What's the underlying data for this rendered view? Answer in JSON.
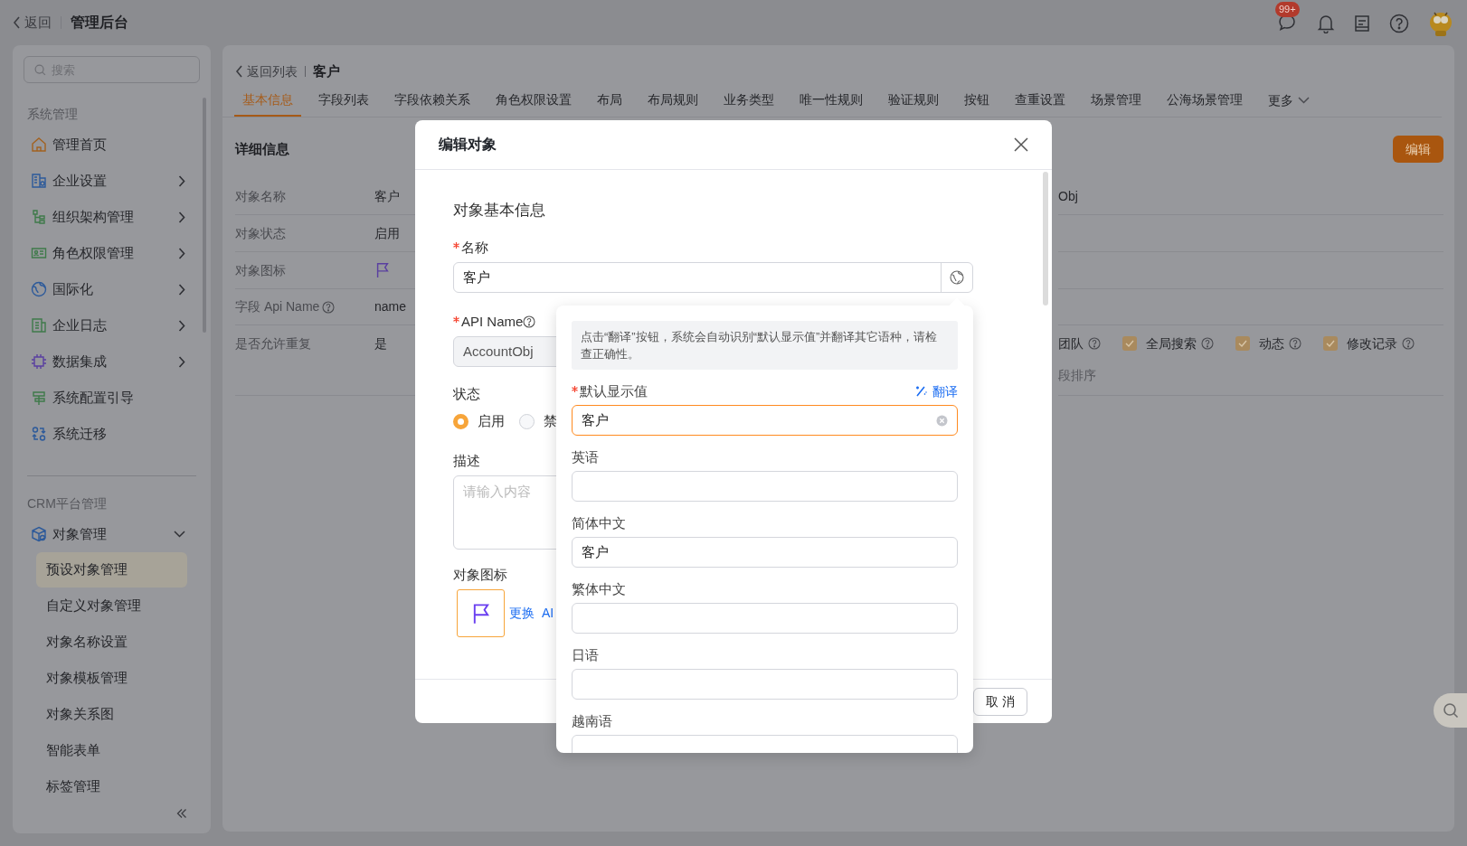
{
  "top_bar": {
    "back": "返回",
    "title": "管理后台",
    "notification_badge": "99+"
  },
  "sidebar": {
    "search_placeholder": "搜索",
    "sections": [
      {
        "title": "系统管理",
        "items": [
          {
            "label": "管理首页",
            "kind": "link"
          },
          {
            "label": "企业设置",
            "kind": "group",
            "expanded": false
          },
          {
            "label": "组织架构管理",
            "kind": "group",
            "expanded": false
          },
          {
            "label": "角色权限管理",
            "kind": "group",
            "expanded": false
          },
          {
            "label": "国际化",
            "kind": "group",
            "expanded": false
          },
          {
            "label": "企业日志",
            "kind": "group",
            "expanded": false
          },
          {
            "label": "数据集成",
            "kind": "group",
            "expanded": false
          },
          {
            "label": "系统配置引导",
            "kind": "link"
          },
          {
            "label": "系统迁移",
            "kind": "link"
          }
        ]
      },
      {
        "title": "CRM平台管理",
        "items": [
          {
            "label": "对象管理",
            "kind": "group",
            "expanded": true,
            "children": [
              {
                "label": "预设对象管理",
                "selected": true
              },
              {
                "label": "自定义对象管理",
                "selected": false
              },
              {
                "label": "对象名称设置",
                "selected": false
              },
              {
                "label": "对象模板管理",
                "selected": false
              },
              {
                "label": "对象关系图",
                "selected": false
              },
              {
                "label": "智能表单",
                "selected": false
              },
              {
                "label": "标签管理",
                "selected": false
              }
            ]
          }
        ]
      }
    ]
  },
  "main": {
    "back": "返回列表",
    "title": "客户",
    "tabs": [
      {
        "label": "基本信息",
        "selected": true
      },
      {
        "label": "字段列表",
        "selected": false
      },
      {
        "label": "字段依赖关系",
        "selected": false
      },
      {
        "label": "角色权限设置",
        "selected": false
      },
      {
        "label": "布局",
        "selected": false
      },
      {
        "label": "布局规则",
        "selected": false
      },
      {
        "label": "业务类型",
        "selected": false
      },
      {
        "label": "唯一性规则",
        "selected": false
      },
      {
        "label": "验证规则",
        "selected": false
      },
      {
        "label": "按钮",
        "selected": false
      },
      {
        "label": "查重设置",
        "selected": false
      },
      {
        "label": "场景管理",
        "selected": false
      },
      {
        "label": "公海场景管理",
        "selected": false
      }
    ],
    "more": "更多",
    "detail": {
      "title": "详细信息",
      "edit_button": "编辑",
      "rows": [
        {
          "label": "对象名称",
          "kind": "text",
          "value": "客户"
        },
        {
          "label": "对象状态",
          "kind": "text",
          "value": "启用"
        },
        {
          "label": "对象图标",
          "kind": "icon"
        },
        {
          "label": "字段 Api Name",
          "kind": "text",
          "help": true,
          "value": "name"
        },
        {
          "label": "是否允许重复",
          "kind": "text",
          "value": "是"
        }
      ],
      "right_value": "Obj",
      "options_lead": "团队",
      "options": [
        {
          "label": "全局搜索",
          "checked": true
        },
        {
          "label": "动态",
          "checked": true
        },
        {
          "label": "修改记录",
          "checked": true
        }
      ],
      "sort_label": "段排序"
    }
  },
  "modal": {
    "title": "编辑对象",
    "section_title": "对象基本信息",
    "name": {
      "label": "名称",
      "required": true,
      "value": "客户"
    },
    "api_name": {
      "label": "API Name",
      "required": true,
      "disabled": true,
      "value": "AccountObj"
    },
    "status": {
      "label": "状态",
      "options": [
        {
          "label": "启用",
          "selected": true
        },
        {
          "label": "禁",
          "selected": false
        }
      ]
    },
    "description": {
      "label": "描述",
      "placeholder": "请输入内容"
    },
    "icon": {
      "label": "对象图标",
      "links": [
        "更换",
        "AI"
      ]
    },
    "cancel_button": "取 消"
  },
  "popover": {
    "hint": "点击“翻译”按钮，系统会自动识别“默认显示值”并翻译其它语种，请检查正确性。",
    "translate_link": "翻译",
    "fields": [
      {
        "label": "默认显示值",
        "required": true,
        "focused": true,
        "value": "客户"
      },
      {
        "label": "英语",
        "required": false,
        "focused": false
      },
      {
        "label": "简体中文",
        "required": false,
        "focused": false,
        "value": "客户"
      },
      {
        "label": "繁体中文",
        "required": false,
        "focused": false
      },
      {
        "label": "日语",
        "required": false,
        "focused": false
      },
      {
        "label": "越南语",
        "required": false,
        "focused": false
      }
    ]
  }
}
